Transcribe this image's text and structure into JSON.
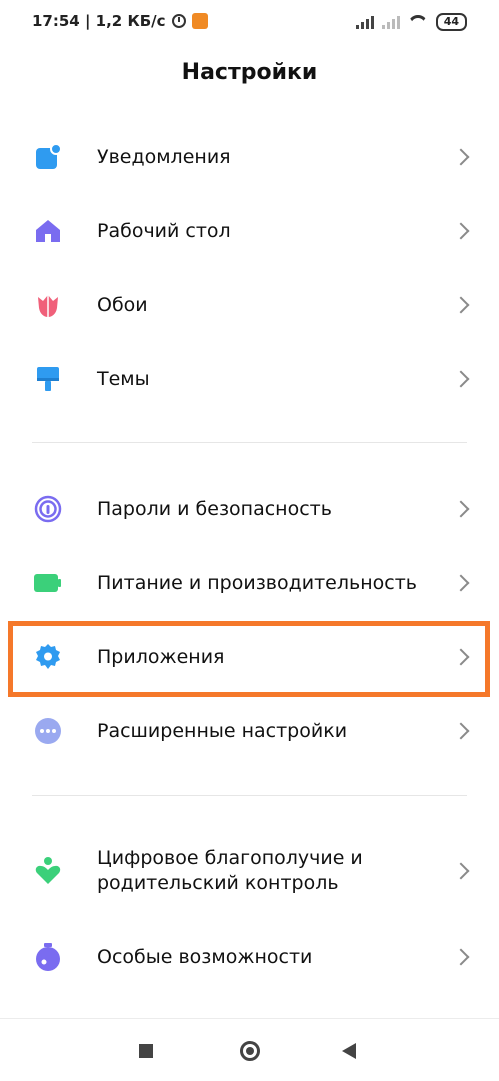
{
  "status_bar": {
    "time_speed": "17:54 | 1,2 КБ/с",
    "battery": "44"
  },
  "header": {
    "title": "Настройки"
  },
  "items": [
    {
      "label": "Уведомления",
      "icon": "notification-icon",
      "color": "#2f9bf0"
    },
    {
      "label": "Рабочий стол",
      "icon": "home-icon",
      "color": "#7a6cf0"
    },
    {
      "label": "Обои",
      "icon": "tulip-icon",
      "color": "#f0607a"
    },
    {
      "label": "Темы",
      "icon": "paint-brush-icon",
      "color": "#2f9bf0"
    },
    {
      "label": "Пароли и безопасность",
      "icon": "fingerprint-icon",
      "color": "#7a6cf0"
    },
    {
      "label": "Питание и производительность",
      "icon": "battery-icon",
      "color": "#3bd07a"
    },
    {
      "label": "Приложения",
      "icon": "gear-icon",
      "color": "#2f9bf0"
    },
    {
      "label": "Расширенные настройки",
      "icon": "more-dots-icon",
      "color": "#9aa9f0"
    },
    {
      "label_line1": "Цифровое благополучие и",
      "label_line2": "родительский контроль",
      "icon": "heart-person-icon",
      "color": "#3bd07a"
    },
    {
      "label": "Особые возможности",
      "icon": "flask-icon",
      "color": "#7a6cf0"
    }
  ],
  "highlight_color": "#f5782a"
}
